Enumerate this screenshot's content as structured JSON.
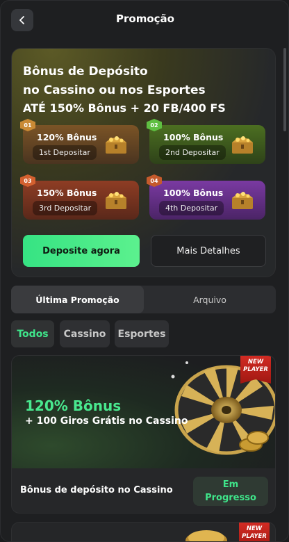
{
  "header": {
    "title": "Promoção"
  },
  "hero": {
    "line1": "Bônus de Depósito",
    "line2": "no Cassino ou nos Esportes",
    "highlight": "ATÉ 150% Bônus + 20 FB/400 FS",
    "tiers": [
      {
        "badge": "01",
        "pct": "120% Bônus",
        "deposit": "1st Depositar",
        "color": "#7b5426"
      },
      {
        "badge": "02",
        "pct": "100% Bônus",
        "deposit": "2nd Depositar",
        "color": "#4c6f21"
      },
      {
        "badge": "03",
        "pct": "150% Bônus",
        "deposit": "3rd Depositar",
        "color": "#8e3d24"
      },
      {
        "badge": "04",
        "pct": "100% Bônus",
        "deposit": "4th Depositar",
        "color": "#7a3aa2"
      }
    ],
    "deposit_button": "Deposite agora",
    "details_button": "Mais Detalhes"
  },
  "tabs": [
    {
      "label": "Última Promoção",
      "active": true
    },
    {
      "label": "Arquivo",
      "active": false
    }
  ],
  "filters": [
    {
      "label": "Todos",
      "active": true
    },
    {
      "label": "Cassino",
      "active": false
    },
    {
      "label": "Esportes",
      "active": false
    }
  ],
  "promo": {
    "ribbon_l1": "NEW",
    "ribbon_l2": "PLAYER",
    "big": "120% Bônus",
    "sub": "+ 100 Giros Grátis no Cassino",
    "footer": "Bônus de depósito no Cassino",
    "status_l1": "Em",
    "status_l2": "Progresso"
  },
  "promo2": {
    "ribbon_l1": "NEW",
    "ribbon_l2": "PLAYER"
  },
  "colors": {
    "accent": "#3fe58a",
    "background": "#1e1f21"
  }
}
